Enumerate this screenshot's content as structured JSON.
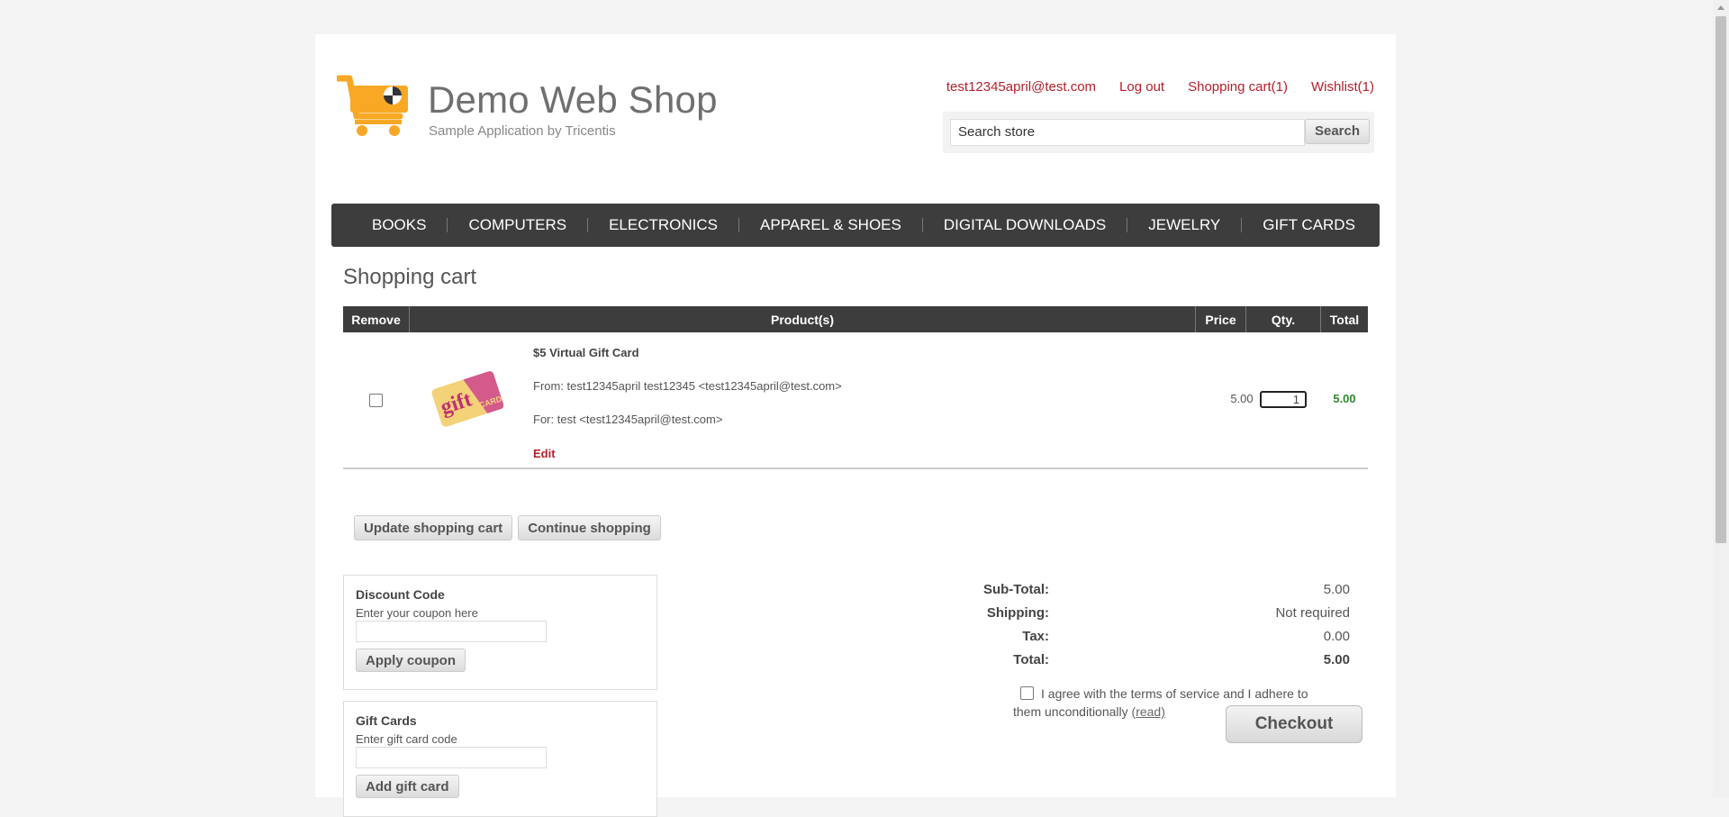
{
  "header": {
    "brand": "Demo Web Shop",
    "tagline": "Sample Application by Tricentis",
    "links": {
      "account": "test12345april@test.com",
      "logout": "Log out",
      "cart": "Shopping cart(1)",
      "wishlist": "Wishlist(1)"
    },
    "search": {
      "value": "Search store",
      "button": "Search"
    }
  },
  "nav": {
    "items": [
      "BOOKS",
      "COMPUTERS",
      "ELECTRONICS",
      "APPAREL & SHOES",
      "DIGITAL DOWNLOADS",
      "JEWELRY",
      "GIFT CARDS"
    ]
  },
  "page_title": "Shopping cart",
  "cart": {
    "headers": {
      "remove": "Remove",
      "product": "Product(s)",
      "price": "Price",
      "qty": "Qty.",
      "total": "Total"
    },
    "item": {
      "name": "$5 Virtual Gift Card",
      "from": "From: test12345april test12345 <test12345april@test.com>",
      "for": "For: test <test12345april@test.com>",
      "edit": "Edit",
      "price": "5.00",
      "qty": "1",
      "total": "5.00",
      "image_text": "gift CARD"
    },
    "buttons": {
      "update": "Update shopping cart",
      "continue": "Continue shopping"
    }
  },
  "discount": {
    "title": "Discount Code",
    "hint": "Enter your coupon here",
    "button": "Apply coupon"
  },
  "giftcards": {
    "title": "Gift Cards",
    "hint": "Enter gift card code",
    "button": "Add gift card"
  },
  "totals": {
    "subtotal_label": "Sub-Total:",
    "subtotal": "5.00",
    "shipping_label": "Shipping:",
    "shipping": "Not required",
    "tax_label": "Tax:",
    "tax": "0.00",
    "total_label": "Total:",
    "total": "5.00"
  },
  "terms": {
    "text": "I agree with the terms of service and I adhere to them unconditionally",
    "link": "(read)"
  },
  "checkout": "Checkout",
  "colors": {
    "link_red": "#b5202a",
    "nav_bg": "#3d3d3d",
    "total_green": "#2e8b2e",
    "logo_orange": "#f9a825"
  }
}
